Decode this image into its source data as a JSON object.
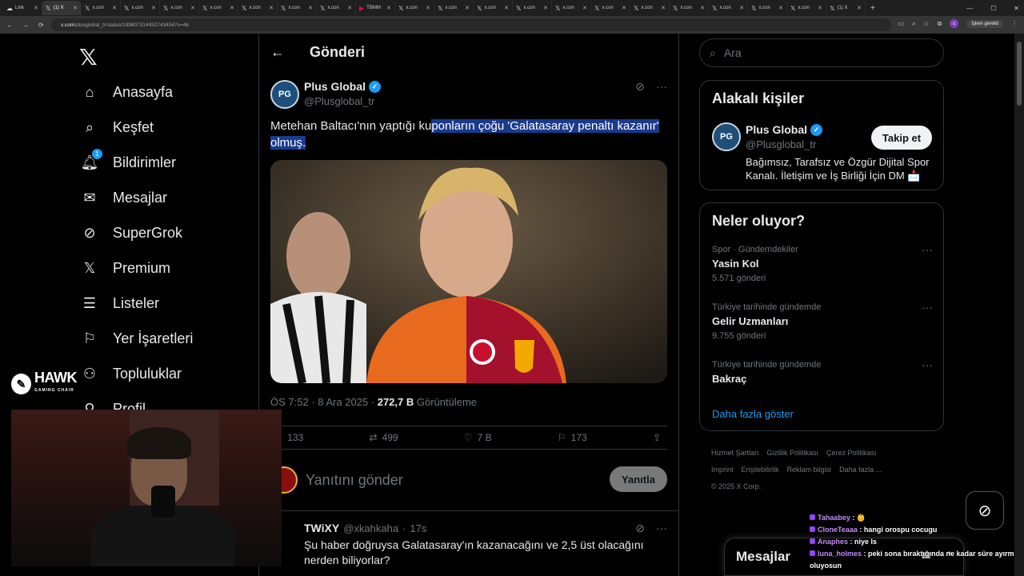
{
  "browser": {
    "tabs": [
      {
        "label": "Link",
        "icon": "link-icon",
        "active": false
      },
      {
        "label": "(1) X",
        "icon": "x-icon",
        "active": true
      },
      {
        "label": "x.con",
        "icon": "x-icon",
        "active": false
      },
      {
        "label": "x.con",
        "icon": "x-icon",
        "active": false
      },
      {
        "label": "x.con",
        "icon": "x-icon",
        "active": false
      },
      {
        "label": "x.con",
        "icon": "x-icon",
        "active": false
      },
      {
        "label": "x.con",
        "icon": "x-icon",
        "active": false
      },
      {
        "label": "x.con",
        "icon": "x-icon",
        "active": false
      },
      {
        "label": "x.con",
        "icon": "x-icon",
        "active": false
      },
      {
        "label": "TBMM",
        "icon": "youtube-icon",
        "active": false
      },
      {
        "label": "x.con",
        "icon": "x-icon",
        "active": false
      },
      {
        "label": "x.con",
        "icon": "x-icon",
        "active": false
      },
      {
        "label": "x.con",
        "icon": "x-icon",
        "active": false
      },
      {
        "label": "x.con",
        "icon": "x-icon",
        "active": false
      },
      {
        "label": "x.con",
        "icon": "x-icon",
        "active": false
      },
      {
        "label": "x.con",
        "icon": "x-icon",
        "active": false
      },
      {
        "label": "x.con",
        "icon": "x-icon",
        "active": false
      },
      {
        "label": "x.con",
        "icon": "x-icon",
        "active": false
      },
      {
        "label": "x.con",
        "icon": "x-icon",
        "active": false
      },
      {
        "label": "x.con",
        "icon": "x-icon",
        "active": false
      },
      {
        "label": "x.con",
        "icon": "x-icon",
        "active": false
      },
      {
        "label": "(1) X",
        "icon": "x-icon",
        "active": false
      }
    ],
    "url_domain": "x.com",
    "url_path": "/plusglobal_tr/status/1998073144527434547s=46",
    "update_label": "İşlem gerekli",
    "profile_initial": "c"
  },
  "nav": {
    "items": [
      {
        "label": "Anasayfa",
        "icon": "home-icon"
      },
      {
        "label": "Keşfet",
        "icon": "search-icon"
      },
      {
        "label": "Bildirimler",
        "icon": "bell-icon",
        "badge": "1"
      },
      {
        "label": "Mesajlar",
        "icon": "mail-icon"
      },
      {
        "label": "SuperGrok",
        "icon": "grok-icon"
      },
      {
        "label": "Premium",
        "icon": "x-premium-icon"
      },
      {
        "label": "Listeler",
        "icon": "list-icon"
      },
      {
        "label": "Yer İşaretleri",
        "icon": "bookmark-icon"
      },
      {
        "label": "Topluluklar",
        "icon": "communities-icon"
      },
      {
        "label": "Profil",
        "icon": "profile-icon"
      }
    ]
  },
  "main": {
    "title": "Gönderi",
    "tweet": {
      "author_name": "Plus Global",
      "author_handle": "@Plusglobal_tr",
      "avatar_initials": "PG",
      "text_before": "Metehan Baltacı'nın yaptığı ku",
      "text_highlight": "ponların çoğu 'Galatasaray penaltı kazanır' olmuş.",
      "time": "ÖS 7:52",
      "date": "8 Ara 2025",
      "views": "272,7 B",
      "views_label": "Görüntüleme",
      "replies": "133",
      "reposts": "499",
      "likes": "7 B",
      "bookmarks": "173"
    },
    "reply_placeholder": "Yanıtını gönder",
    "reply_button": "Yanıtla",
    "reply": {
      "name": "TWiXY",
      "handle": "@xkahkaha",
      "time": "17s",
      "text": "Şu haber doğruysa Galatasaray'ın kazanacağını ve 2,5 üst olacağını nerden biliyorlar?"
    }
  },
  "sidebar": {
    "search_placeholder": "Ara",
    "related": {
      "title": "Alakalı kişiler",
      "name": "Plus Global",
      "handle": "@Plusglobal_tr",
      "bio": "Bağımsız, Tarafsız ve Özgür Dijital Spor Kanalı. İletişim ve İş Birliği İçin DM 📩",
      "follow": "Takip et"
    },
    "trends": {
      "title": "Neler oluyor?",
      "items": [
        {
          "category": "Spor · Gündemdekiler",
          "name": "Yasin Kol",
          "count": "5.571 gönderi"
        },
        {
          "category": "Türkiye tarihinde gündemde",
          "name": "Gelir Uzmanları",
          "count": "9.755 gönderi"
        },
        {
          "category": "Türkiye tarihinde gündemde",
          "name": "Bakraç",
          "count": ""
        }
      ],
      "show_more": "Daha fazla göster"
    },
    "footer": {
      "links_row1": [
        "Hizmet Şartları",
        "Gizlilik Politikası",
        "Çerez Politikası"
      ],
      "links_row2": [
        "Imprint",
        "Erişilebilirlik",
        "Reklam bilgisi",
        "Daha fazla ..."
      ],
      "copyright": "© 2025 X Corp."
    }
  },
  "messages_drawer": {
    "title": "Mesajlar"
  },
  "overlay": {
    "brand": "HAWK",
    "brand_sub": "GAMING CHAIR",
    "chat": [
      {
        "user": "Tahaabey",
        "message": "👶"
      },
      {
        "user": "CloneTeaaa",
        "message": "hangi orospu cocugu"
      },
      {
        "user": "Anaphes",
        "message": "niye ls"
      },
      {
        "user": "luna_holmes",
        "message": "peki sona bıraktığında ne kadar süre ayırmış oluyosun"
      }
    ]
  }
}
